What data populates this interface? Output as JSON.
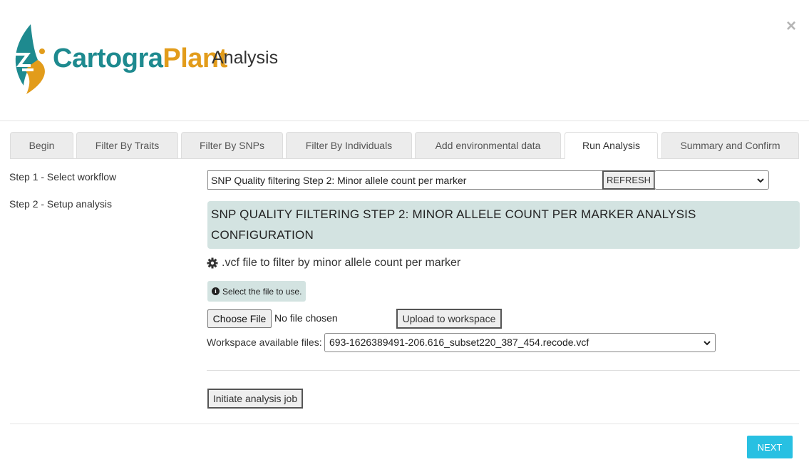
{
  "header": {
    "brand_part1": "Cartogra",
    "brand_part2": "Plant",
    "brand_suffix": "Analysis",
    "close_label": "×",
    "brand_colors": {
      "teal": "#1e8a8f",
      "orange": "#e29c1b"
    }
  },
  "tabs": [
    {
      "label": "Begin",
      "active": false
    },
    {
      "label": "Filter By Traits",
      "active": false
    },
    {
      "label": "Filter By SNPs",
      "active": false
    },
    {
      "label": "Filter By Individuals",
      "active": false
    },
    {
      "label": "Add environmental data",
      "active": false
    },
    {
      "label": "Run Analysis",
      "active": true
    },
    {
      "label": "Summary and Confirm",
      "active": false
    }
  ],
  "steps": [
    {
      "label": "Step 1 - Select workflow"
    },
    {
      "label": "Step 2 - Setup analysis"
    }
  ],
  "workflow": {
    "value": "SNP Quality filtering Step 2: Minor allele count per marker",
    "refresh_label": "REFRESH",
    "select_value": ""
  },
  "config": {
    "heading": "SNP QUALITY FILTERING STEP 2: MINOR ALLELE COUNT PER MARKER ANALYSIS CONFIGURATION",
    "file_label": ".vcf file to filter by minor allele count per marker",
    "hint": "Select the file to use.",
    "choose_file_label": "Choose File",
    "no_file_label": "No file chosen",
    "upload_label": "Upload to workspace",
    "workspace_label": "Workspace available files:",
    "workspace_value": "693-1626389491-206.616_subset220_387_454.recode.vcf",
    "initiate_label": "Initiate analysis job"
  },
  "footer": {
    "next_label": "NEXT",
    "next_color": "#28c0e2"
  },
  "icons": {
    "logo": "cartograplant-leaf-logo",
    "settings": "gear-icon",
    "info": "info-icon",
    "chevron": "chevron-down-icon"
  }
}
